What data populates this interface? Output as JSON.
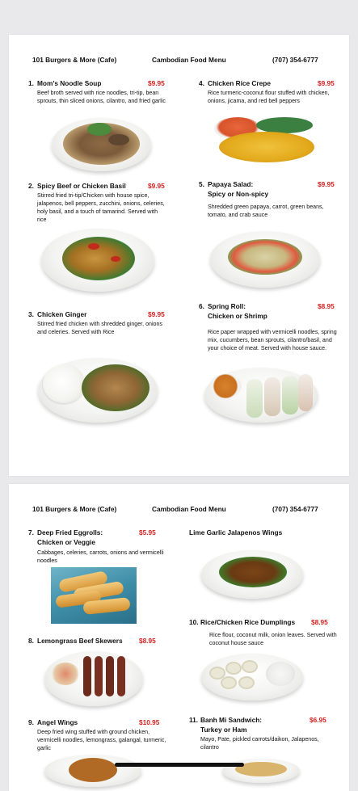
{
  "header": {
    "cafe": "101 Burgers & More (Cafe)",
    "menu": "Cambodian Food Menu",
    "phone": "(707) 354-6777"
  },
  "page1": {
    "items": [
      {
        "num": "1.",
        "name": "Mom’s Noodle Soup",
        "price": "$9.95",
        "desc": "Beef broth served with rice noodles, tri-tip, bean sprouts, thin sliced onions, cilantro, and fried garlic"
      },
      {
        "num": "2.",
        "name": "Spicy Beef or Chicken Basil",
        "price": "$9.95",
        "desc": "Stirred fried tri-tip/Chicken with house spice, jalapenos, bell peppers, zucchini, onions, celeries, holy basil, and a touch of tamarind. Served with rice"
      },
      {
        "num": "3.",
        "name": "Chicken Ginger",
        "price": "$9.95",
        "desc": "Stirred fried chicken with shredded ginger, onions and celeries. Served with Rice"
      },
      {
        "num": "4.",
        "name": "Chicken Rice Crepe",
        "price": "$9.95",
        "desc": "Rice turmeric-coconut flour stuffed with chicken, onions, jicama, and red bell peppers"
      },
      {
        "num": "5.",
        "name": "Papaya Salad:",
        "sub": "Spicy or Non-spicy",
        "price": "$9.95",
        "desc": "Shredded green papaya, carrot, green beans, tomato, and crab sauce"
      },
      {
        "num": "6.",
        "name": "Spring Roll:",
        "sub": "Chicken or Shrimp",
        "price": "$8.95",
        "desc": "Rice paper wrapped with vermicelli noodles, spring mix, cucumbers, bean sprouts, cilantro/basil, and your choice of meat. Served with house sauce."
      }
    ]
  },
  "page2": {
    "items": [
      {
        "num": "7.",
        "name": "Deep Fried Eggrolls:",
        "sub": "Chicken or Veggie",
        "price": "$5.95",
        "desc": "Cabbages, celeries, carrots, onions and vermicelli noodles"
      },
      {
        "num": "8.",
        "name": "Lemongrass Beef Skewers",
        "price": "$8.95",
        "desc": ""
      },
      {
        "num": "9.",
        "name": "Angel Wings",
        "price": "$10.95",
        "desc": "Deep fried wing stuffed with ground chicken, vermicelli noodles, lemongrass, galangal, turmeric, garlic"
      },
      {
        "num": "",
        "name": "Lime Garlic Jalapenos Wings",
        "price": "",
        "desc": ""
      },
      {
        "num": "10.",
        "name": "Rice/Chicken Rice Dumplings",
        "price": "$8.95",
        "desc": "Rice flour, coconut milk, onion leaves. Served with coconut house sauce"
      },
      {
        "num": "11.",
        "name": "Banh Mi Sandwich:",
        "sub": "Turkey or Ham",
        "price": "$6.95",
        "desc": "Mayo, Pate, pickled carrots/daikon, Jalapenos, cilantro"
      }
    ]
  },
  "colors": {
    "price": "#d42020",
    "page_bg": "#ffffff",
    "screen_bg": "#e9e9ec"
  }
}
